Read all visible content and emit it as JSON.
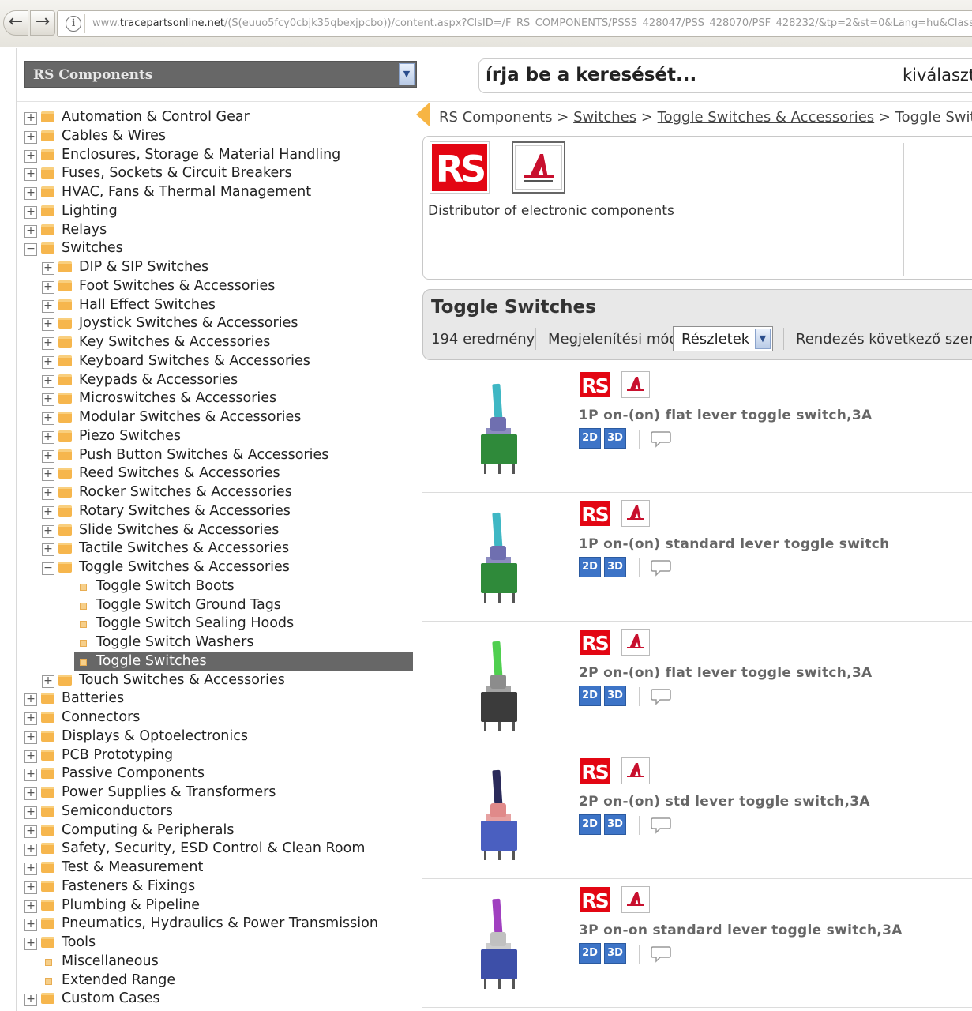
{
  "browser": {
    "url_prefix": "www.",
    "url_domain": "tracepartsonline.net",
    "url_rest": "/(S(euuo5fcy0cbjk35qbexjpcbo))/content.aspx?ClsID=/F_RS_COMPONENTS/PSSS_428047/PSS_428070/PSF_428232/&tp=2&st=0&Lang=hu&Class="
  },
  "brand_select": {
    "value": "RS Components"
  },
  "search": {
    "placeholder": "írja be a keresését...",
    "choose_label": "kiválaszto"
  },
  "tree": [
    {
      "label": "Automation & Control Gear",
      "level": 0,
      "type": "folder",
      "expander": "+"
    },
    {
      "label": "Cables & Wires",
      "level": 0,
      "type": "folder",
      "expander": "+"
    },
    {
      "label": "Enclosures, Storage & Material Handling",
      "level": 0,
      "type": "folder",
      "expander": "+"
    },
    {
      "label": "Fuses, Sockets & Circuit Breakers",
      "level": 0,
      "type": "folder",
      "expander": "+"
    },
    {
      "label": "HVAC, Fans & Thermal Management",
      "level": 0,
      "type": "folder",
      "expander": "+"
    },
    {
      "label": "Lighting",
      "level": 0,
      "type": "folder",
      "expander": "+"
    },
    {
      "label": "Relays",
      "level": 0,
      "type": "folder",
      "expander": "+"
    },
    {
      "label": "Switches",
      "level": 0,
      "type": "folder",
      "expander": "−"
    },
    {
      "label": "DIP & SIP Switches",
      "level": 1,
      "type": "folder",
      "expander": "+"
    },
    {
      "label": "Foot Switches & Accessories",
      "level": 1,
      "type": "folder",
      "expander": "+"
    },
    {
      "label": "Hall Effect Switches",
      "level": 1,
      "type": "folder",
      "expander": "+"
    },
    {
      "label": "Joystick Switches & Accessories",
      "level": 1,
      "type": "folder",
      "expander": "+"
    },
    {
      "label": "Key Switches & Accessories",
      "level": 1,
      "type": "folder",
      "expander": "+"
    },
    {
      "label": "Keyboard Switches & Accessories",
      "level": 1,
      "type": "folder",
      "expander": "+"
    },
    {
      "label": "Keypads & Accessories",
      "level": 1,
      "type": "folder",
      "expander": "+"
    },
    {
      "label": "Microswitches & Accessories",
      "level": 1,
      "type": "folder",
      "expander": "+"
    },
    {
      "label": "Modular Switches & Accessories",
      "level": 1,
      "type": "folder",
      "expander": "+"
    },
    {
      "label": "Piezo Switches",
      "level": 1,
      "type": "folder",
      "expander": "+"
    },
    {
      "label": "Push Button Switches & Accessories",
      "level": 1,
      "type": "folder",
      "expander": "+"
    },
    {
      "label": "Reed Switches & Accessories",
      "level": 1,
      "type": "folder",
      "expander": "+"
    },
    {
      "label": "Rocker Switches & Accessories",
      "level": 1,
      "type": "folder",
      "expander": "+"
    },
    {
      "label": "Rotary Switches & Accessories",
      "level": 1,
      "type": "folder",
      "expander": "+"
    },
    {
      "label": "Slide Switches & Accessories",
      "level": 1,
      "type": "folder",
      "expander": "+"
    },
    {
      "label": "Tactile Switches & Accessories",
      "level": 1,
      "type": "folder",
      "expander": "+"
    },
    {
      "label": "Toggle Switches & Accessories",
      "level": 1,
      "type": "folder",
      "expander": "−"
    },
    {
      "label": "Toggle Switch Boots",
      "level": 2,
      "type": "leaf"
    },
    {
      "label": "Toggle Switch Ground Tags",
      "level": 2,
      "type": "leaf"
    },
    {
      "label": "Toggle Switch Sealing Hoods",
      "level": 2,
      "type": "leaf"
    },
    {
      "label": "Toggle Switch Washers",
      "level": 2,
      "type": "leaf"
    },
    {
      "label": "Toggle Switches",
      "level": 2,
      "type": "leaf",
      "selected": true
    },
    {
      "label": "Touch Switches & Accessories",
      "level": 1,
      "type": "folder",
      "expander": "+"
    },
    {
      "label": "Batteries",
      "level": 0,
      "type": "folder",
      "expander": "+"
    },
    {
      "label": "Connectors",
      "level": 0,
      "type": "folder",
      "expander": "+"
    },
    {
      "label": "Displays & Optoelectronics",
      "level": 0,
      "type": "folder",
      "expander": "+"
    },
    {
      "label": "PCB Prototyping",
      "level": 0,
      "type": "folder",
      "expander": "+"
    },
    {
      "label": "Passive Components",
      "level": 0,
      "type": "folder",
      "expander": "+"
    },
    {
      "label": "Power Supplies & Transformers",
      "level": 0,
      "type": "folder",
      "expander": "+"
    },
    {
      "label": "Semiconductors",
      "level": 0,
      "type": "folder",
      "expander": "+"
    },
    {
      "label": "Computing & Peripherals",
      "level": 0,
      "type": "folder",
      "expander": "+"
    },
    {
      "label": "Safety, Security, ESD Control & Clean Room",
      "level": 0,
      "type": "folder",
      "expander": "+"
    },
    {
      "label": "Test & Measurement",
      "level": 0,
      "type": "folder",
      "expander": "+"
    },
    {
      "label": "Fasteners & Fixings",
      "level": 0,
      "type": "folder",
      "expander": "+"
    },
    {
      "label": "Plumbing & Pipeline",
      "level": 0,
      "type": "folder",
      "expander": "+"
    },
    {
      "label": "Pneumatics, Hydraulics & Power Transmission",
      "level": 0,
      "type": "folder",
      "expander": "+"
    },
    {
      "label": "Tools",
      "level": 0,
      "type": "folder",
      "expander": "+"
    },
    {
      "label": "Miscellaneous",
      "level": 0,
      "type": "leaf"
    },
    {
      "label": "Extended Range",
      "level": 0,
      "type": "leaf"
    },
    {
      "label": "Custom Cases",
      "level": 0,
      "type": "folder",
      "expander": "+"
    }
  ],
  "breadcrumb": {
    "root": "RS Components",
    "sep": ">",
    "level1": "Switches",
    "level2": "Toggle Switches & Accessories",
    "current": "Toggle Switches"
  },
  "supplier": {
    "description": "Distributor of electronic components"
  },
  "listing": {
    "title": "Toggle Switches",
    "count": "194 eredmény",
    "mode_label": "Megjelenítési mód",
    "mode_value": "Részletek",
    "sort_label": "Rendezés következő szerin"
  },
  "products": [
    {
      "name": "1P on-(on) flat lever toggle switch,3A",
      "lever_color": "#3fb7c4",
      "body_color": "#2f8a3a",
      "nut_color": "#6f6fb0"
    },
    {
      "name": "1P on-(on) standard lever toggle switch",
      "lever_color": "#3fb7c4",
      "body_color": "#2f8a3a",
      "nut_color": "#6f6fb0"
    },
    {
      "name": "2P on-(on) flat lever toggle switch,3A",
      "lever_color": "#4fcf4f",
      "body_color": "#3b3b3b",
      "nut_color": "#8c8c8c"
    },
    {
      "name": "2P on-(on) std lever toggle switch,3A",
      "lever_color": "#2a2a5a",
      "body_color": "#4a5fc0",
      "nut_color": "#e08a8a"
    },
    {
      "name": "3P on-on standard lever toggle switch,3A",
      "lever_color": "#a040c0",
      "body_color": "#3d4fa8",
      "nut_color": "#c0c0c0"
    }
  ],
  "product_buttons": {
    "two_d": "2D",
    "three_d": "3D"
  },
  "colors": {
    "rs_red": "#e30613",
    "accent_orange": "#f7b544",
    "selected_bg": "#676767"
  }
}
